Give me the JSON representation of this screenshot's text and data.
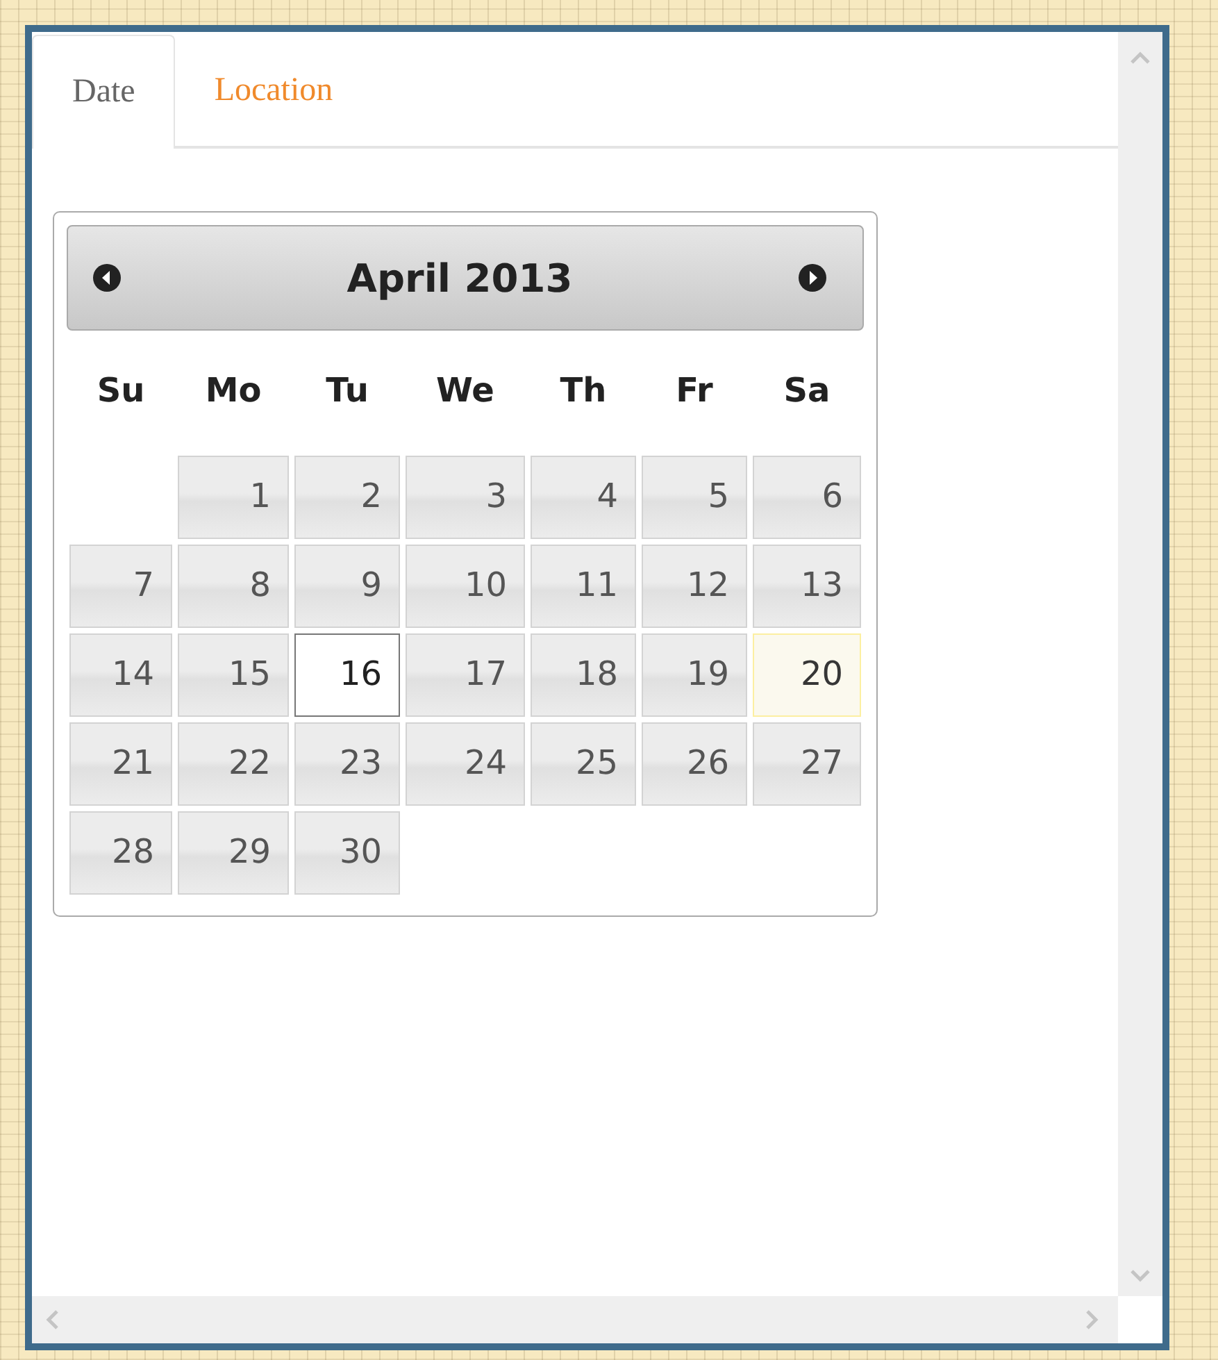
{
  "tabs": [
    {
      "label": "Date",
      "selected": true
    },
    {
      "label": "Location",
      "selected": false
    }
  ],
  "calendar": {
    "title": "April 2013",
    "weekdays": [
      "Su",
      "Mo",
      "Tu",
      "We",
      "Th",
      "Fr",
      "Sa"
    ],
    "weeks": [
      {
        "kind": "partial",
        "days": [
          {
            "day": "1",
            "selected": false,
            "today": false
          },
          {
            "day": "2",
            "selected": false,
            "today": false
          },
          {
            "day": "3",
            "selected": false,
            "today": false
          },
          {
            "day": "4",
            "selected": false,
            "today": false
          },
          {
            "day": "5",
            "selected": false,
            "today": false
          },
          {
            "day": "6",
            "selected": false,
            "today": false
          }
        ]
      },
      {
        "kind": "full",
        "days": [
          {
            "day": "7",
            "selected": false,
            "today": false
          },
          {
            "day": "8",
            "selected": false,
            "today": false
          },
          {
            "day": "9",
            "selected": false,
            "today": false
          },
          {
            "day": "10",
            "selected": false,
            "today": false
          },
          {
            "day": "11",
            "selected": false,
            "today": false
          },
          {
            "day": "12",
            "selected": false,
            "today": false
          },
          {
            "day": "13",
            "selected": false,
            "today": false
          }
        ]
      },
      {
        "kind": "full",
        "days": [
          {
            "day": "14",
            "selected": false,
            "today": false
          },
          {
            "day": "15",
            "selected": false,
            "today": false
          },
          {
            "day": "16",
            "selected": true,
            "today": false
          },
          {
            "day": "17",
            "selected": false,
            "today": false
          },
          {
            "day": "18",
            "selected": false,
            "today": false
          },
          {
            "day": "19",
            "selected": false,
            "today": false
          },
          {
            "day": "20",
            "selected": false,
            "today": true
          }
        ]
      },
      {
        "kind": "full",
        "days": [
          {
            "day": "21",
            "selected": false,
            "today": false
          },
          {
            "day": "22",
            "selected": false,
            "today": false
          },
          {
            "day": "23",
            "selected": false,
            "today": false
          },
          {
            "day": "24",
            "selected": false,
            "today": false
          },
          {
            "day": "25",
            "selected": false,
            "today": false
          },
          {
            "day": "26",
            "selected": false,
            "today": false
          },
          {
            "day": "27",
            "selected": false,
            "today": false
          }
        ]
      },
      {
        "kind": "trailing",
        "days": [
          {
            "day": "28",
            "selected": false,
            "today": false
          },
          {
            "day": "29",
            "selected": false,
            "today": false
          },
          {
            "day": "30",
            "selected": false,
            "today": false
          }
        ]
      }
    ]
  }
}
